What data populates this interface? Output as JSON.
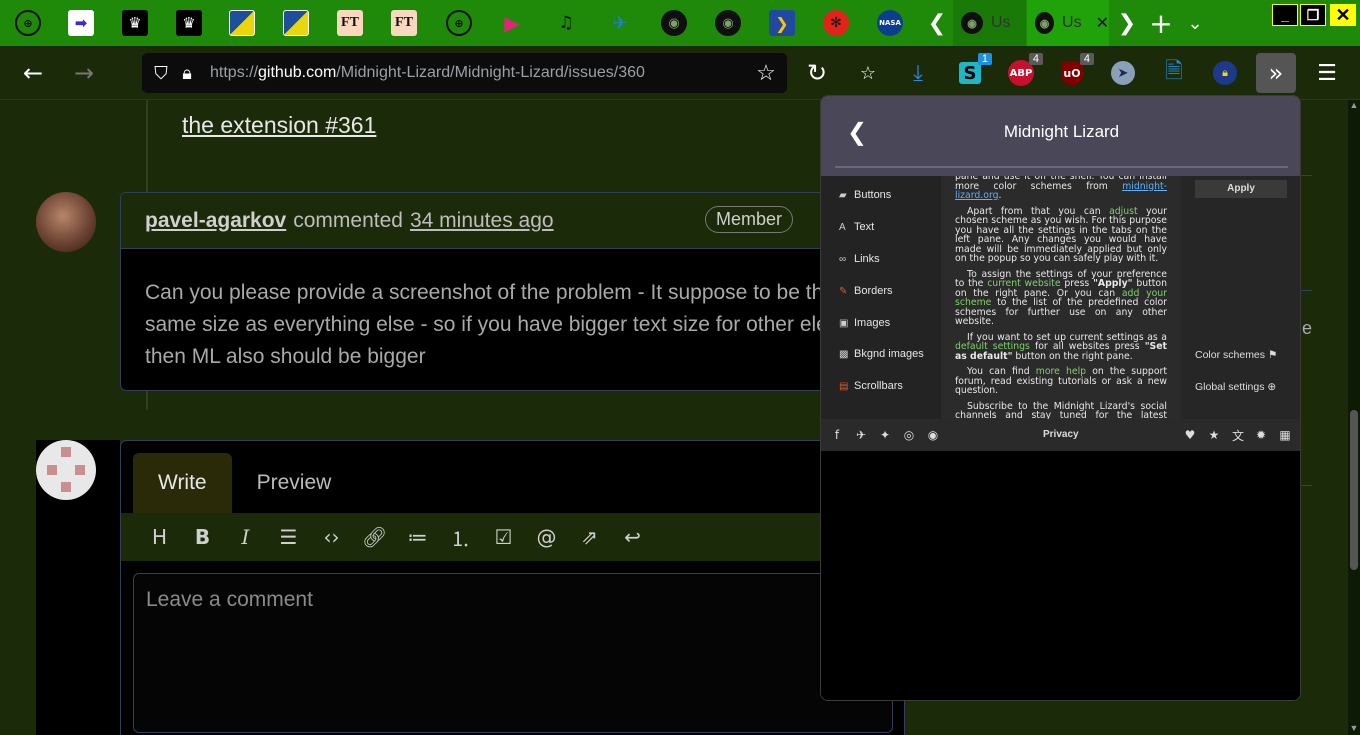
{
  "tabstrip": {
    "pinned": [
      {
        "icon": "globe-icon",
        "glyph": "⊕"
      },
      {
        "icon": "arrow-right-icon",
        "glyph": "➡"
      },
      {
        "icon": "crown-icon",
        "glyph": "♛"
      },
      {
        "icon": "crown-icon",
        "glyph": "♛"
      },
      {
        "icon": "half-square-icon",
        "glyph": ""
      },
      {
        "icon": "half-square-icon",
        "glyph": ""
      },
      {
        "icon": "ft-icon",
        "glyph": "FT"
      },
      {
        "icon": "ft-icon",
        "glyph": "FT"
      },
      {
        "icon": "globe-icon",
        "glyph": "⊕"
      },
      {
        "icon": "play-icon",
        "glyph": "▶"
      },
      {
        "icon": "headphones-icon",
        "glyph": "🎧"
      },
      {
        "icon": "rocket-icon",
        "glyph": "✈"
      },
      {
        "icon": "github-icon",
        "glyph": "◉"
      },
      {
        "icon": "github-icon",
        "glyph": "◉"
      },
      {
        "icon": "chevron-icon",
        "glyph": "❯"
      },
      {
        "icon": "wheel-icon",
        "glyph": "✻"
      },
      {
        "icon": "nasa-icon",
        "glyph": "NASA"
      }
    ],
    "tabs": [
      {
        "label": "Us"
      },
      {
        "label": "Us"
      }
    ]
  },
  "navbar": {
    "url_prefix": "https://",
    "url_host": "github.com",
    "url_path": "/Midnight-Lizard/Midnight-Lizard/issues/360",
    "badges": {
      "s": "1",
      "abp": "4",
      "ublock": "4"
    }
  },
  "page": {
    "linked_issue": "the extension #361",
    "comment": {
      "author": "pavel-agarkov",
      "verb": "commented",
      "time": "34 minutes ago",
      "role": "Member",
      "body_lines": [
        "Can you please provide a screenshot of the problem - It suppose to be the",
        "same size as everything else - so if you have bigger text size for other ele",
        "then ML also should be bigger"
      ]
    },
    "editor": {
      "tab_write": "Write",
      "tab_preview": "Preview",
      "placeholder": "Leave a comment"
    }
  },
  "popup": {
    "title": "Midnight Lizard",
    "sidebar": [
      "Buttons",
      "Text",
      "Links",
      "Borders",
      "Images",
      "Bkgnd images",
      "Scrollbars"
    ],
    "apply": "Apply",
    "color_schemes": "Color schemes",
    "global_settings": "Global settings",
    "privacy": "Privacy",
    "help": {
      "p0a": "pane and use it off the shelf. You can install more color schemes from ",
      "p0link": "midnight-lizard.org",
      "p0b": ".",
      "p1a": "Apart from that you can ",
      "p1g": "adjust",
      "p1b": " your chosen scheme as you wish. For this purpose you have all the settings in the tabs on the left pane. Any changes you would have made will be immediately applied but only on the popup so you can safely play with it.",
      "p2a": "To assign the settings of your preference to the ",
      "p2g": "current website",
      "p2b": " press ",
      "p2h": "\"Apply\"",
      "p2c": " button on the right pane. Or you can ",
      "p2g2": "add your scheme",
      "p2d": " to the list of the predefined color schemes for further use on any other website.",
      "p3a": "If you want to set up current settings as a ",
      "p3g": "default settings",
      "p3b": " for all websites press ",
      "p3h": "\"Set as default\"",
      "p3c": " button on the right pane.",
      "p4a": "You can find ",
      "p4g": "more help",
      "p4b": " on the support forum, read existing tutorials or ask a new question.",
      "p5": "Subscribe to the Midnight Lizard's social channels and stay tuned for the latest updates and the new features."
    }
  }
}
